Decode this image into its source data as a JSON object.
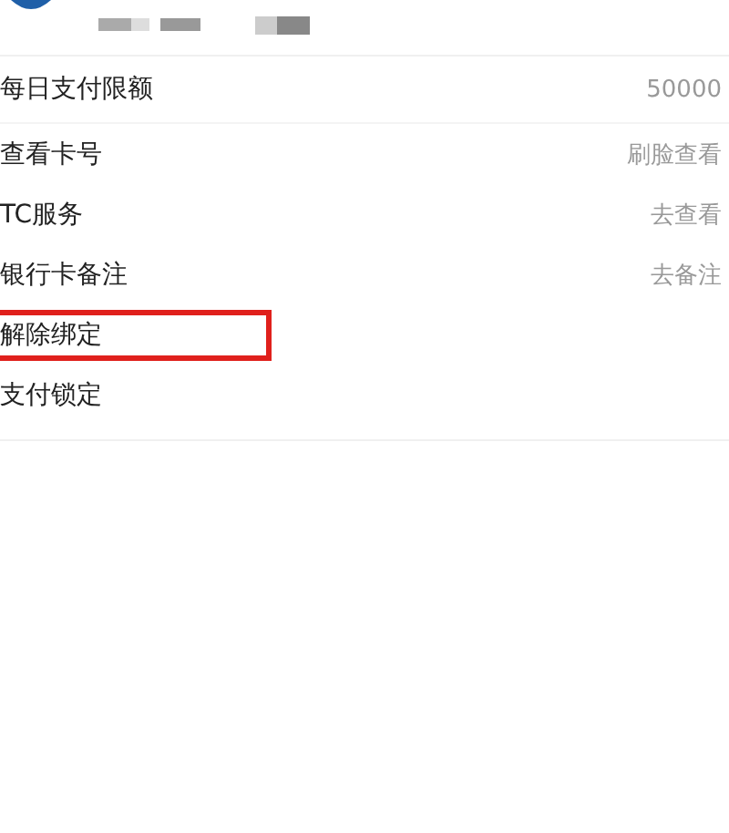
{
  "rows": [
    {
      "label": "每日支付限额",
      "value": "50000"
    },
    {
      "label": "查看卡号",
      "value": "刷脸查看"
    },
    {
      "label": "TC服务",
      "value": "去查看"
    },
    {
      "label": "银行卡备注",
      "value": "去备注"
    },
    {
      "label": "解除绑定",
      "highlighted": true
    },
    {
      "label": "支付锁定",
      "highlighted": false
    }
  ]
}
